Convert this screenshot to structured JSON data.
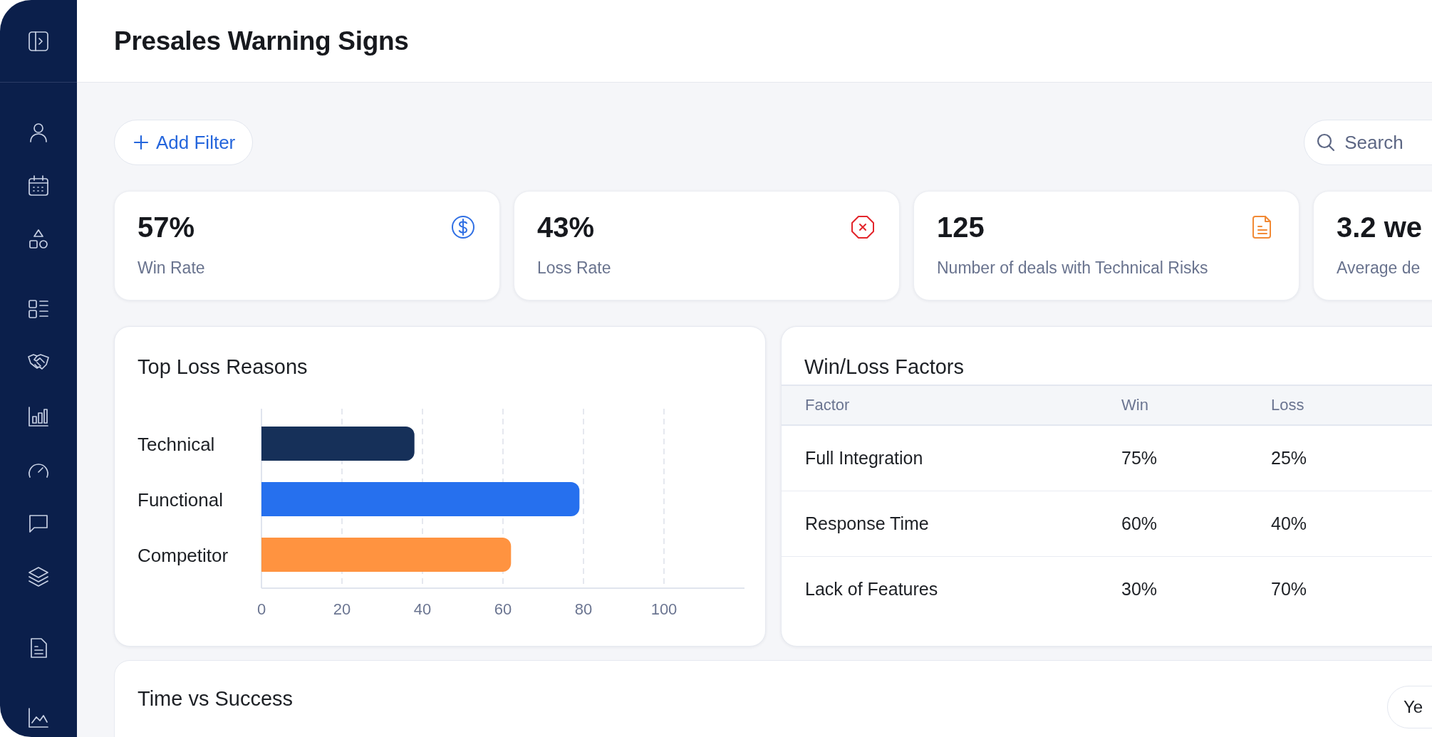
{
  "header": {
    "title": "Presales Warning Signs"
  },
  "toolbar": {
    "add_filter": "Add Filter",
    "search": {
      "placeholder": "Search"
    }
  },
  "stats": [
    {
      "value": "57%",
      "label": "Win Rate",
      "kind": "dollar",
      "color": "#2f6fe4"
    },
    {
      "value": "43%",
      "label": "Loss Rate",
      "kind": "stop",
      "color": "#e3262c"
    },
    {
      "value": "125",
      "label": "Number of deals with Technical Risks",
      "kind": "document",
      "color": "#f28a35"
    },
    {
      "value": "3.2 we",
      "label": "Average de"
    }
  ],
  "loss_chart": {
    "title": "Top Loss Reasons",
    "chart_data": {
      "type": "bar",
      "orientation": "horizontal",
      "stacked": true,
      "categories": [
        "Technical",
        "Functional",
        "Competitor"
      ],
      "series": [
        {
          "color": "#163059",
          "values": [
            38,
            null,
            null
          ]
        },
        {
          "color": "#2670ee",
          "values": [
            null,
            79,
            null
          ]
        },
        {
          "color": "#ff9340",
          "values": [
            null,
            null,
            62
          ]
        }
      ],
      "xlim": [
        0,
        120
      ],
      "xticks": [
        0,
        20,
        40,
        60,
        80,
        100
      ],
      "grid": true
    }
  },
  "factors_table": {
    "title": "Win/Loss Factors",
    "columns": [
      "Factor",
      "Win",
      "Loss"
    ],
    "rows": [
      [
        "Full Integration",
        "75%",
        "25%"
      ],
      [
        "Response Time",
        "60%",
        "40%"
      ],
      [
        "Lack of Features",
        "30%",
        "70%"
      ]
    ]
  },
  "time_panel": {
    "title": "Time vs Success",
    "button": "Ye"
  }
}
